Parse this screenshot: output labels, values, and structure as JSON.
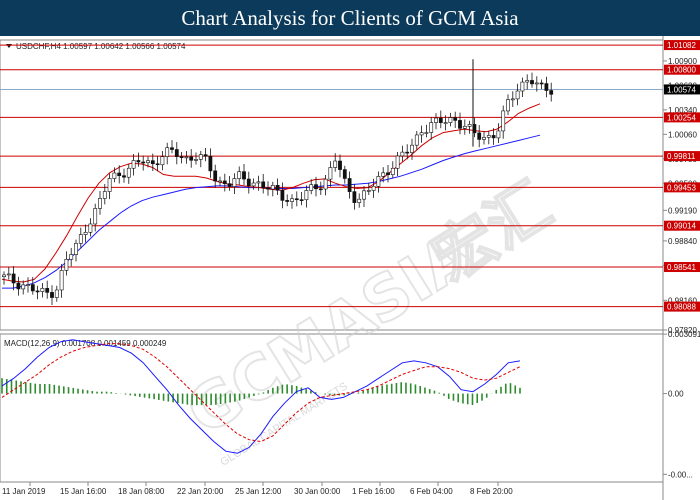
{
  "banner": {
    "title": "Chart Analysis for Clients of GCM Asia"
  },
  "watermark": {
    "brand": "GCMASIA",
    "cn": "宏汇",
    "sub": "GLOBAL CAPITAL MARKETS"
  },
  "chart_data": [
    {
      "type": "candlestick",
      "symbol_header": "USDCHF,H4  1.00597 1.00642 1.00566 1.00574",
      "ylim": [
        0.9782,
        1.0114
      ],
      "y_ticks": [
        "1.00900",
        "1.00620",
        "1.00340",
        "1.00060",
        "0.99780",
        "0.99500",
        "0.99190",
        "0.98840",
        "0.98560",
        "0.98160",
        "0.97820"
      ],
      "horizontal_levels": [
        1.01082,
        1.008,
        1.00254,
        0.99811,
        0.99453,
        0.99014,
        0.98541,
        0.98088
      ],
      "level_labels": [
        "1.01082",
        "1.00800",
        "1.00254",
        "0.99811",
        "0.99453",
        "0.99014",
        "0.98541",
        "0.98088"
      ],
      "current_price": 1.00574,
      "current_price_label": "1.00574",
      "x_ticks": [
        "11 Jan 2019",
        "15 Jan 16:00",
        "18 Jan 08:00",
        "22 Jan 20:00",
        "25 Jan 12:00",
        "30 Jan 00:00",
        "1 Feb 16:00",
        "6 Feb 04:00",
        "8 Feb 20:00"
      ],
      "close_path": [
        0.9843,
        0.9838,
        0.9834,
        0.9827,
        0.9823,
        0.9828,
        0.9862,
        0.988,
        0.9905,
        0.9925,
        0.9955,
        0.9962,
        0.9968,
        0.9976,
        0.9972,
        0.9984,
        0.9985,
        0.9978,
        0.9982,
        0.9974,
        0.9952,
        0.995,
        0.9956,
        0.9952,
        0.995,
        0.9942,
        0.9936,
        0.993,
        0.9934,
        0.9946,
        0.9952,
        0.9978,
        0.9945,
        0.9932,
        0.994,
        0.9954,
        0.9968,
        0.998,
        0.999,
        1.0012,
        1.0018,
        1.002,
        1.0024,
        1.0016,
        1.0004,
        1.0002,
        1.0009,
        1.004,
        1.006,
        1.0072,
        1.0057
      ],
      "ma_fast": [
        0.984,
        0.9838,
        0.9837,
        0.984,
        0.9852,
        0.987,
        0.989,
        0.9912,
        0.9933,
        0.995,
        0.9962,
        0.9969,
        0.9973,
        0.9972,
        0.9968,
        0.996,
        0.9958,
        0.9958,
        0.9958,
        0.9956,
        0.9952,
        0.9949,
        0.9948,
        0.9946,
        0.9945,
        0.9943,
        0.9942,
        0.9945,
        0.995,
        0.9954,
        0.9955,
        0.995,
        0.9946,
        0.9944,
        0.9945,
        0.9952,
        0.9962,
        0.9972,
        0.9982,
        0.9993,
        1.0002,
        1.0008,
        1.001,
        1.0012,
        1.001,
        1.0009,
        1.0012,
        1.002,
        1.003,
        1.0036,
        1.0041
      ],
      "ma_slow": [
        0.983,
        0.983,
        0.9832,
        0.9836,
        0.9842,
        0.985,
        0.986,
        0.9872,
        0.9884,
        0.9896,
        0.9906,
        0.9916,
        0.9924,
        0.993,
        0.9934,
        0.9937,
        0.994,
        0.9943,
        0.9945,
        0.9946,
        0.9947,
        0.9947,
        0.9946,
        0.9945,
        0.9945,
        0.9944,
        0.9944,
        0.9944,
        0.9945,
        0.9946,
        0.9947,
        0.9948,
        0.9948,
        0.9949,
        0.995,
        0.9952,
        0.9955,
        0.9958,
        0.9962,
        0.9966,
        0.9971,
        0.9976,
        0.998,
        0.9984,
        0.9987,
        0.999,
        0.9993,
        0.9996,
        0.9999,
        1.0002,
        1.0005
      ]
    },
    {
      "type": "line",
      "title": "MACD(12,26,9) 0.001708 0.001459 0.000249",
      "ylim": [
        -0.0046,
        0.0031
      ],
      "y_ticks": [
        "0.003091",
        "0.00",
        "-0.00..."
      ],
      "y_tick_values": [
        0.003091,
        0.0,
        -0.0042
      ],
      "series": [
        {
          "values": [
            0.0004,
            0.0008,
            0.0013,
            0.0019,
            0.0024,
            0.0027,
            0.0028,
            0.0027,
            0.0026,
            0.0025,
            0.0024,
            0.0021,
            0.0016,
            0.0009,
            0.0002,
            -0.0006,
            -0.0013,
            -0.0019,
            -0.0025,
            -0.003,
            -0.0031,
            -0.0028,
            -0.0021,
            -0.0012,
            -0.0005,
            0.0001,
            0.0003,
            -0.0002,
            -0.0003,
            -0.0002,
            0.0001,
            0.0004,
            0.0008,
            0.0012,
            0.0016,
            0.0017,
            0.0016,
            0.0014,
            0.0009,
            0.0002,
            0.0001,
            0.0005,
            0.001,
            0.0016,
            0.0017
          ]
        },
        {
          "values": [
            -0.0002,
            0.0002,
            0.0006,
            0.001,
            0.0015,
            0.0019,
            0.0022,
            0.0024,
            0.0025,
            0.0026,
            0.0026,
            0.0025,
            0.0023,
            0.0019,
            0.0014,
            0.0008,
            0.0002,
            -0.0004,
            -0.001,
            -0.0016,
            -0.0021,
            -0.0024,
            -0.0025,
            -0.0022,
            -0.0016,
            -0.001,
            -0.0005,
            -0.0002,
            -0.0001,
            0.0,
            0.0001,
            0.0002,
            0.0004,
            0.0007,
            0.001,
            0.0012,
            0.0014,
            0.0014,
            0.0013,
            0.0011,
            0.0008,
            0.0007,
            0.0008,
            0.0011,
            0.0014
          ]
        },
        {
          "type": "bar",
          "values": [
            0.0008,
            0.0007,
            0.0006,
            0.0005,
            0.0005,
            0.0004,
            0.0003,
            0.0002,
            0.0001,
            0.0001,
            0.0,
            -0.0001,
            -0.0002,
            -0.0003,
            -0.0004,
            -0.0005,
            -0.0006,
            -0.0006,
            -0.0006,
            -0.0005,
            -0.0004,
            -0.0002,
            0.0,
            0.0003,
            0.0005,
            0.0004,
            0.0002,
            0.0,
            -0.0001,
            -0.0001,
            0.0,
            0.0002,
            0.0004,
            0.0005,
            0.0006,
            0.0005,
            0.0003,
            0.0001,
            -0.0003,
            -0.0005,
            -0.0006,
            -0.0003,
            0.0002,
            0.0006,
            0.0003
          ]
        }
      ],
      "x_ticks": [
        "11 Jan 2019",
        "15 Jan 16:00",
        "18 Jan 08:00",
        "22 Jan 20:00",
        "25 Jan 12:00",
        "30 Jan 00:00",
        "1 Feb 16:00",
        "6 Feb 04:00",
        "8 Feb 20:00"
      ]
    }
  ],
  "colors": {
    "banner": "#0b3a5a",
    "level": "#cc0000",
    "bid_line": "#7a9cc0",
    "ma_fast": "#d00000",
    "ma_slow": "#1a1aff",
    "macd": "#1a1aff",
    "signal": "#e00000",
    "histogram": "#2e8b2e",
    "candle": "#111111"
  }
}
